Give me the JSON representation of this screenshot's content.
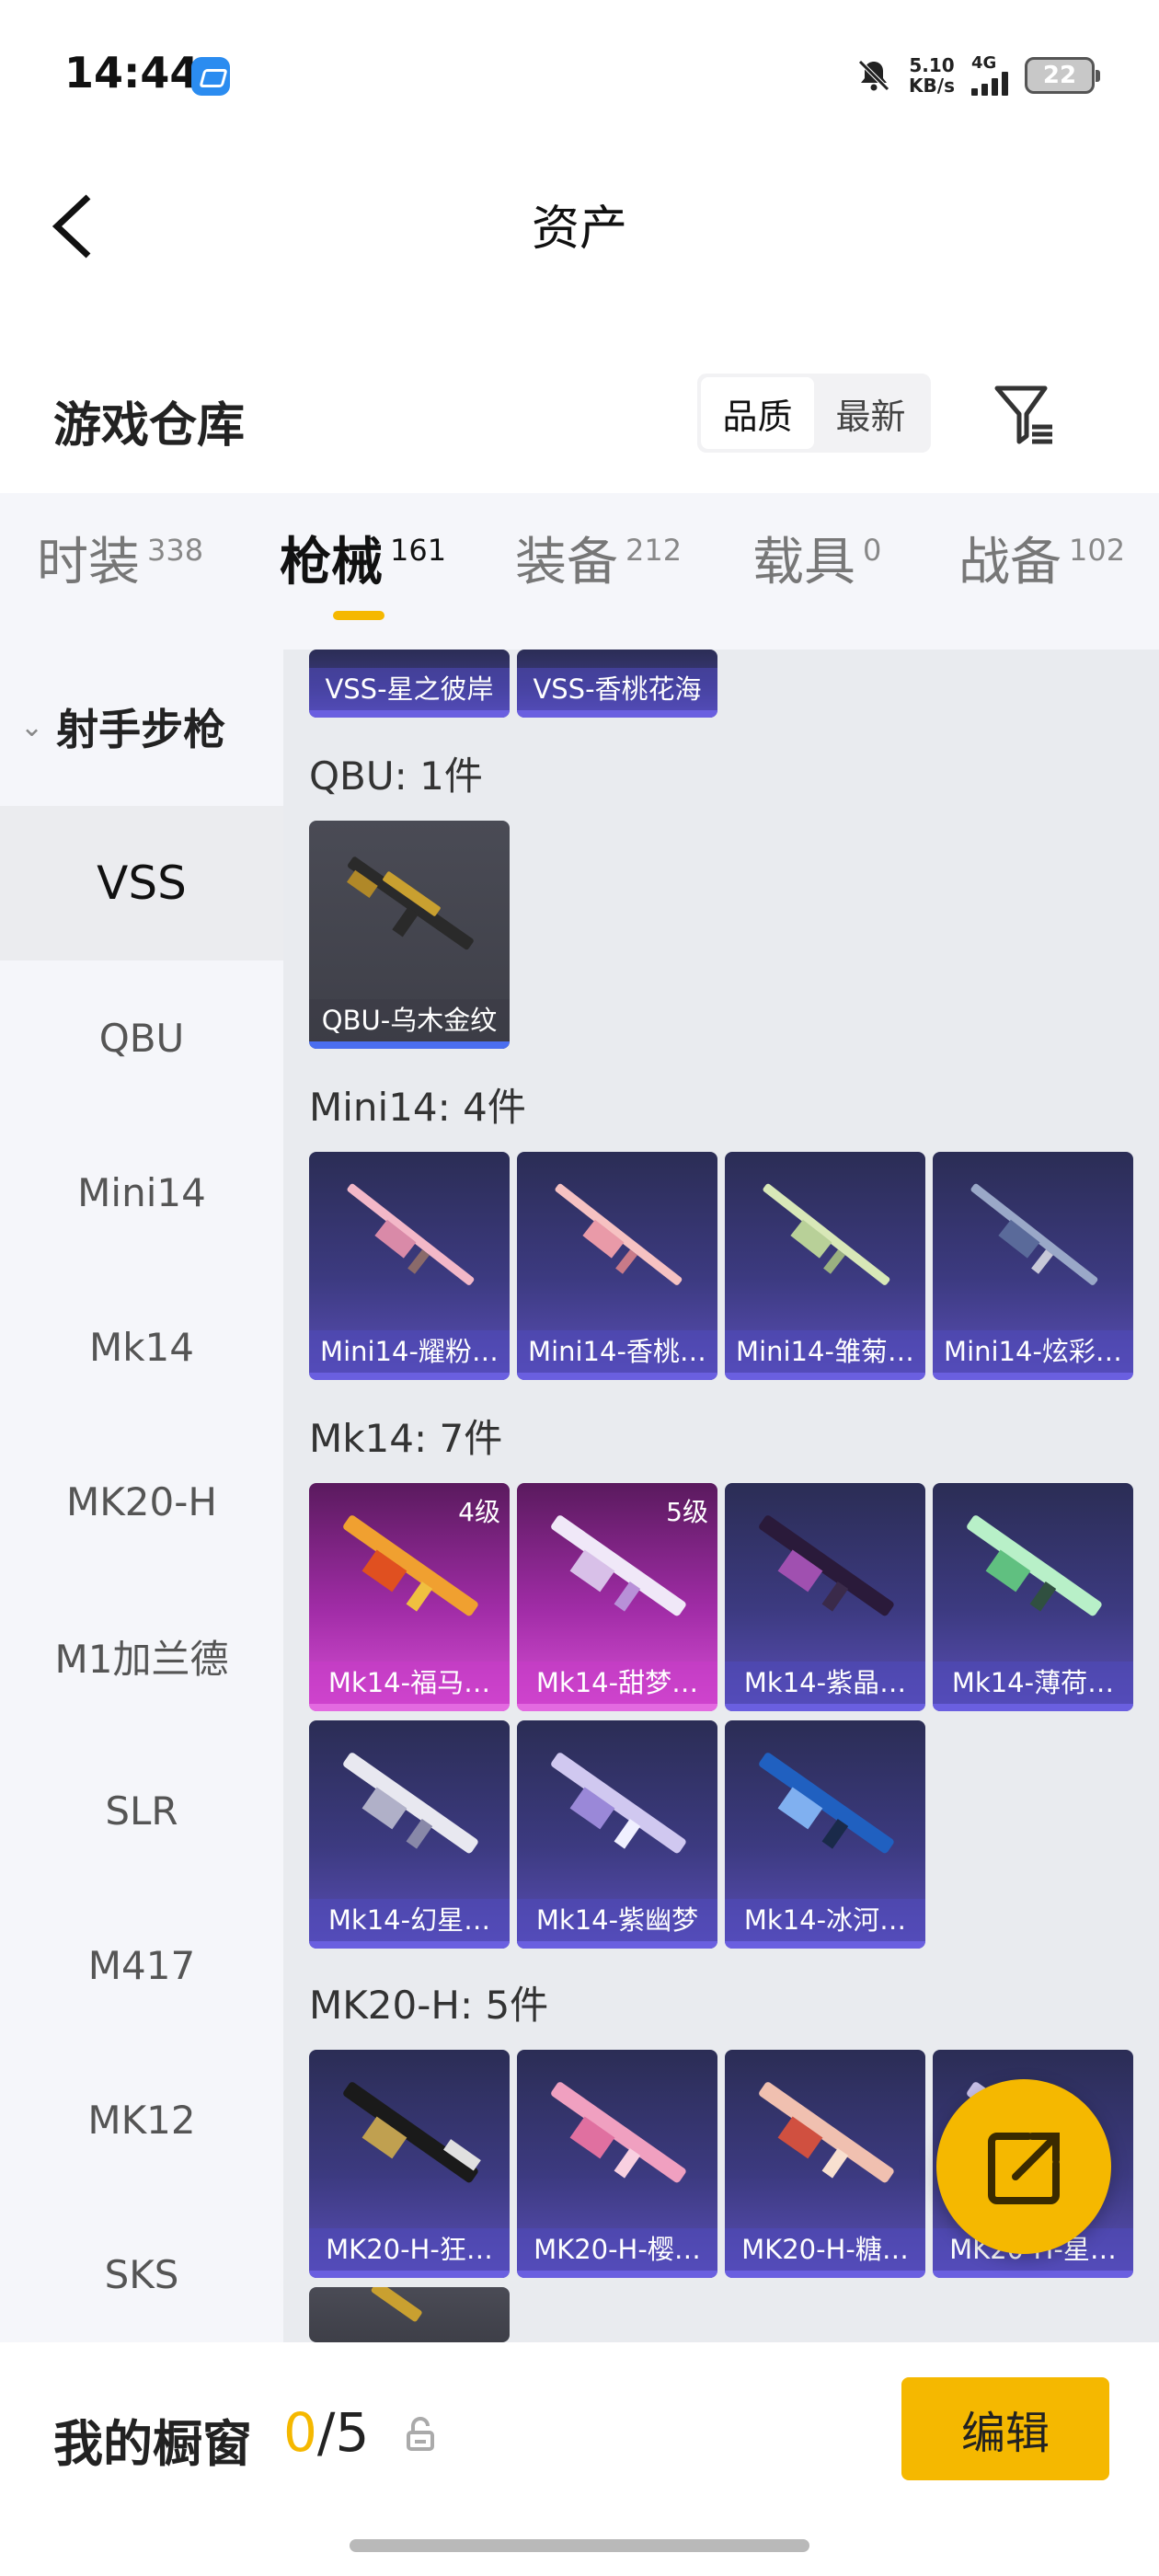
{
  "status_bar": {
    "time": "14:44",
    "net_speed_value": "5.10",
    "net_speed_unit": "KB/s",
    "network": "4G",
    "battery": "22",
    "icons": [
      "app-icon",
      "bell-muted-icon",
      "signal-icon",
      "battery-icon"
    ]
  },
  "header": {
    "title": "资产",
    "back_icon": "chevron-left-icon"
  },
  "warehouse": {
    "title": "游戏仓库",
    "sort_options": [
      "品质",
      "最新"
    ],
    "sort_selected": "品质",
    "filter_icon": "filter-icon"
  },
  "tabs": [
    {
      "label": "时装",
      "count": "338"
    },
    {
      "label": "枪械",
      "count": "161",
      "active": true
    },
    {
      "label": "装备",
      "count": "212"
    },
    {
      "label": "载具",
      "count": "0"
    },
    {
      "label": "战备",
      "count": "102"
    }
  ],
  "sidebar": {
    "category": "射手步枪",
    "items": [
      "VSS",
      "QBU",
      "Mini14",
      "Mk14",
      "MK20-H",
      "M1加兰德",
      "SLR",
      "M417",
      "MK12",
      "SKS"
    ],
    "selected": "VSS"
  },
  "groups": {
    "vss": {
      "items": [
        {
          "name": "VSS-星之彼岸"
        },
        {
          "name": "VSS-香桃花海"
        }
      ]
    },
    "qbu": {
      "title": "QBU: 1件",
      "items": [
        {
          "name": "QBU-乌木金纹"
        }
      ]
    },
    "mini14": {
      "title": "Mini14: 4件",
      "items": [
        {
          "name": "Mini14-耀粉…"
        },
        {
          "name": "Mini14-香桃…"
        },
        {
          "name": "Mini14-雏菊…"
        },
        {
          "name": "Mini14-炫彩…"
        }
      ]
    },
    "mk14": {
      "title": "Mk14: 7件",
      "items": [
        {
          "name": "Mk14-福马…",
          "level": "4级"
        },
        {
          "name": "Mk14-甜梦…",
          "level": "5级"
        },
        {
          "name": "Mk14-紫晶…"
        },
        {
          "name": "Mk14-薄荷…"
        },
        {
          "name": "Mk14-幻星…"
        },
        {
          "name": "Mk14-紫幽梦"
        },
        {
          "name": "Mk14-冰河…"
        }
      ]
    },
    "mk20h": {
      "title": "MK20-H: 5件",
      "items": [
        {
          "name": "MK20-H-狂…"
        },
        {
          "name": "MK20-H-樱…"
        },
        {
          "name": "MK20-H-糖…"
        },
        {
          "name": "MK20-H-星…"
        }
      ]
    }
  },
  "fab": {
    "icon": "share-external-icon"
  },
  "bottom_bar": {
    "label": "我的橱窗",
    "count_current": "0",
    "count_total": "/5",
    "lock_icon": "lock-icon",
    "edit_label": "编辑"
  },
  "colors": {
    "accent": "#f5b800",
    "card_purple": "#3c3a80",
    "card_pink": "#a02ca6",
    "panel_bg": "#e9ebef",
    "sidebar_bg": "#f5f6fa"
  }
}
